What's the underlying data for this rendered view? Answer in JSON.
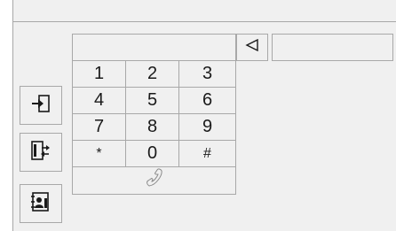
{
  "dial_display": {
    "number": ""
  },
  "side_display": {
    "text": ""
  },
  "keypad": {
    "keys": [
      "1",
      "2",
      "3",
      "4",
      "5",
      "6",
      "7",
      "8",
      "9",
      "*",
      "0",
      "#"
    ]
  },
  "icons": {
    "backspace": "backspace-icon",
    "call": "handset-icon",
    "enter": "enter-icon",
    "transfer": "phone-transfer-icon",
    "contacts": "contacts-book-icon"
  }
}
